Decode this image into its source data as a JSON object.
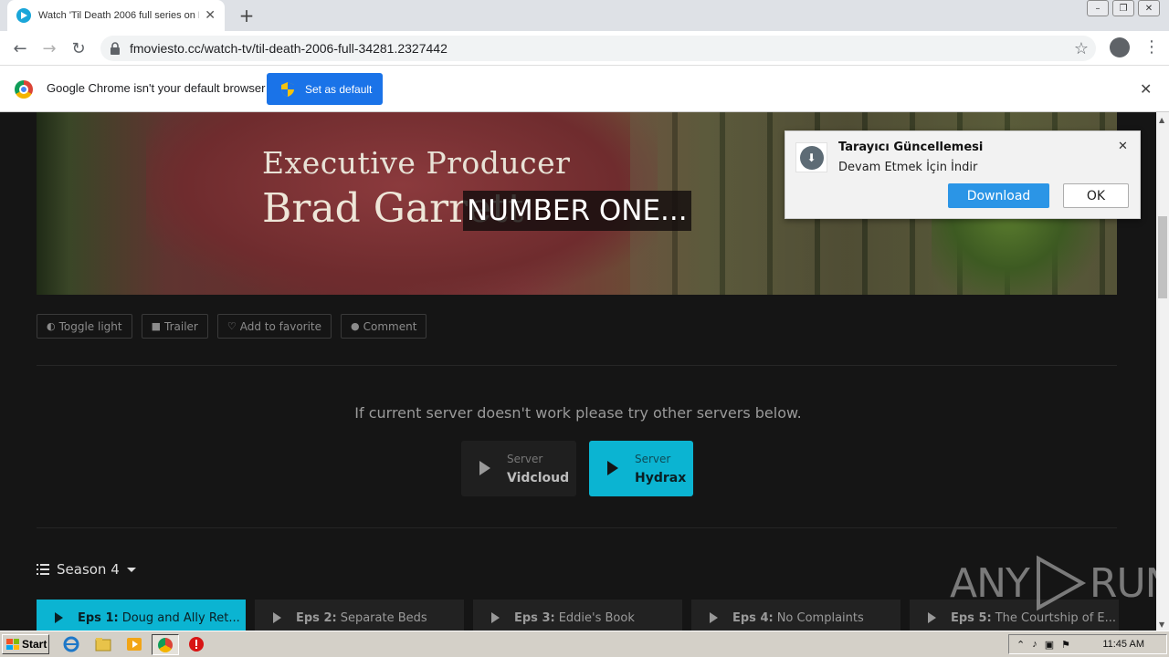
{
  "browser": {
    "tab_title": "Watch 'Til Death 2006 full series on F",
    "url": "fmoviesto.cc/watch-tv/til-death-2006-full-34281.2327442",
    "infobar_text": "Google Chrome isn't your default browser",
    "set_default_label": "Set as default"
  },
  "video": {
    "credit_line1": "Executive Producer",
    "credit_line2": "Brad Garrett",
    "subtitle": "NUMBER ONE..."
  },
  "actions": [
    {
      "label": "Toggle light",
      "icon": "half-circle-icon"
    },
    {
      "label": "Trailer",
      "icon": "video-camera-icon"
    },
    {
      "label": "Add to favorite",
      "icon": "heart-icon"
    },
    {
      "label": "Comment",
      "icon": "comment-icon"
    }
  ],
  "servers": {
    "note": "If current server doesn't work please try other servers below.",
    "items": [
      {
        "label": "Server",
        "name": "Vidcloud",
        "active": false
      },
      {
        "label": "Server",
        "name": "Hydrax",
        "active": true
      }
    ]
  },
  "season": {
    "label": "Season 4"
  },
  "episodes": [
    {
      "num": "Eps 1:",
      "title": "Doug and Ally Ret...",
      "active": true
    },
    {
      "num": "Eps 2:",
      "title": "Separate Beds",
      "active": false
    },
    {
      "num": "Eps 3:",
      "title": "Eddie's Book",
      "active": false
    },
    {
      "num": "Eps 4:",
      "title": "No Complaints",
      "active": false
    },
    {
      "num": "Eps 5:",
      "title": "The Courtship of E...",
      "active": false
    }
  ],
  "popup": {
    "title": "Tarayıcı Güncellemesi",
    "message": "Devam Etmek İçin İndir",
    "download_label": "Download",
    "ok_label": "OK"
  },
  "watermark": {
    "left": "ANY",
    "right": "RUN"
  },
  "taskbar": {
    "start_label": "Start",
    "clock": "11:45 AM"
  },
  "colors": {
    "accent": "#0bb4d2",
    "chrome_blue": "#1a73e8",
    "download_blue": "#2b95e6"
  }
}
